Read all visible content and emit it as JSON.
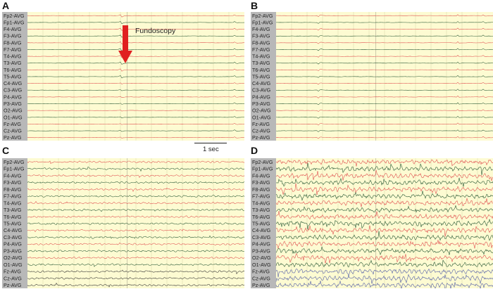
{
  "panels": [
    {
      "letter": "A",
      "activity": "quiet"
    },
    {
      "letter": "B",
      "activity": "quiet"
    },
    {
      "letter": "C",
      "activity": "moderate"
    },
    {
      "letter": "D",
      "activity": "high"
    }
  ],
  "channels": [
    "Fp2-AVG",
    "Fp1-AVG",
    "F4-AVG",
    "F3-AVG",
    "F8-AVG",
    "F7-AVG",
    "T4-AVG",
    "T3-AVG",
    "T6-AVG",
    "T5-AVG",
    "C4-AVG",
    "C3-AVG",
    "P4-AVG",
    "P3-AVG",
    "O2-AVG",
    "O1-AVG",
    "Fz-AVG",
    "Cz-AVG",
    "Pz-AVG"
  ],
  "annotation": {
    "text": "Fundoscopy",
    "arrow_icon": "down-arrow-icon",
    "arrow_color": "#e02020"
  },
  "scale_bar": {
    "label": "1 sec"
  },
  "colors": {
    "background": "#fdfbd2",
    "label_column": "#b8b8b8",
    "grid": "#dad6a8",
    "trace_red": "#e05050",
    "trace_green": "#2a5a36",
    "trace_dark": "#333333",
    "trace_blue": "#5560a8"
  }
}
